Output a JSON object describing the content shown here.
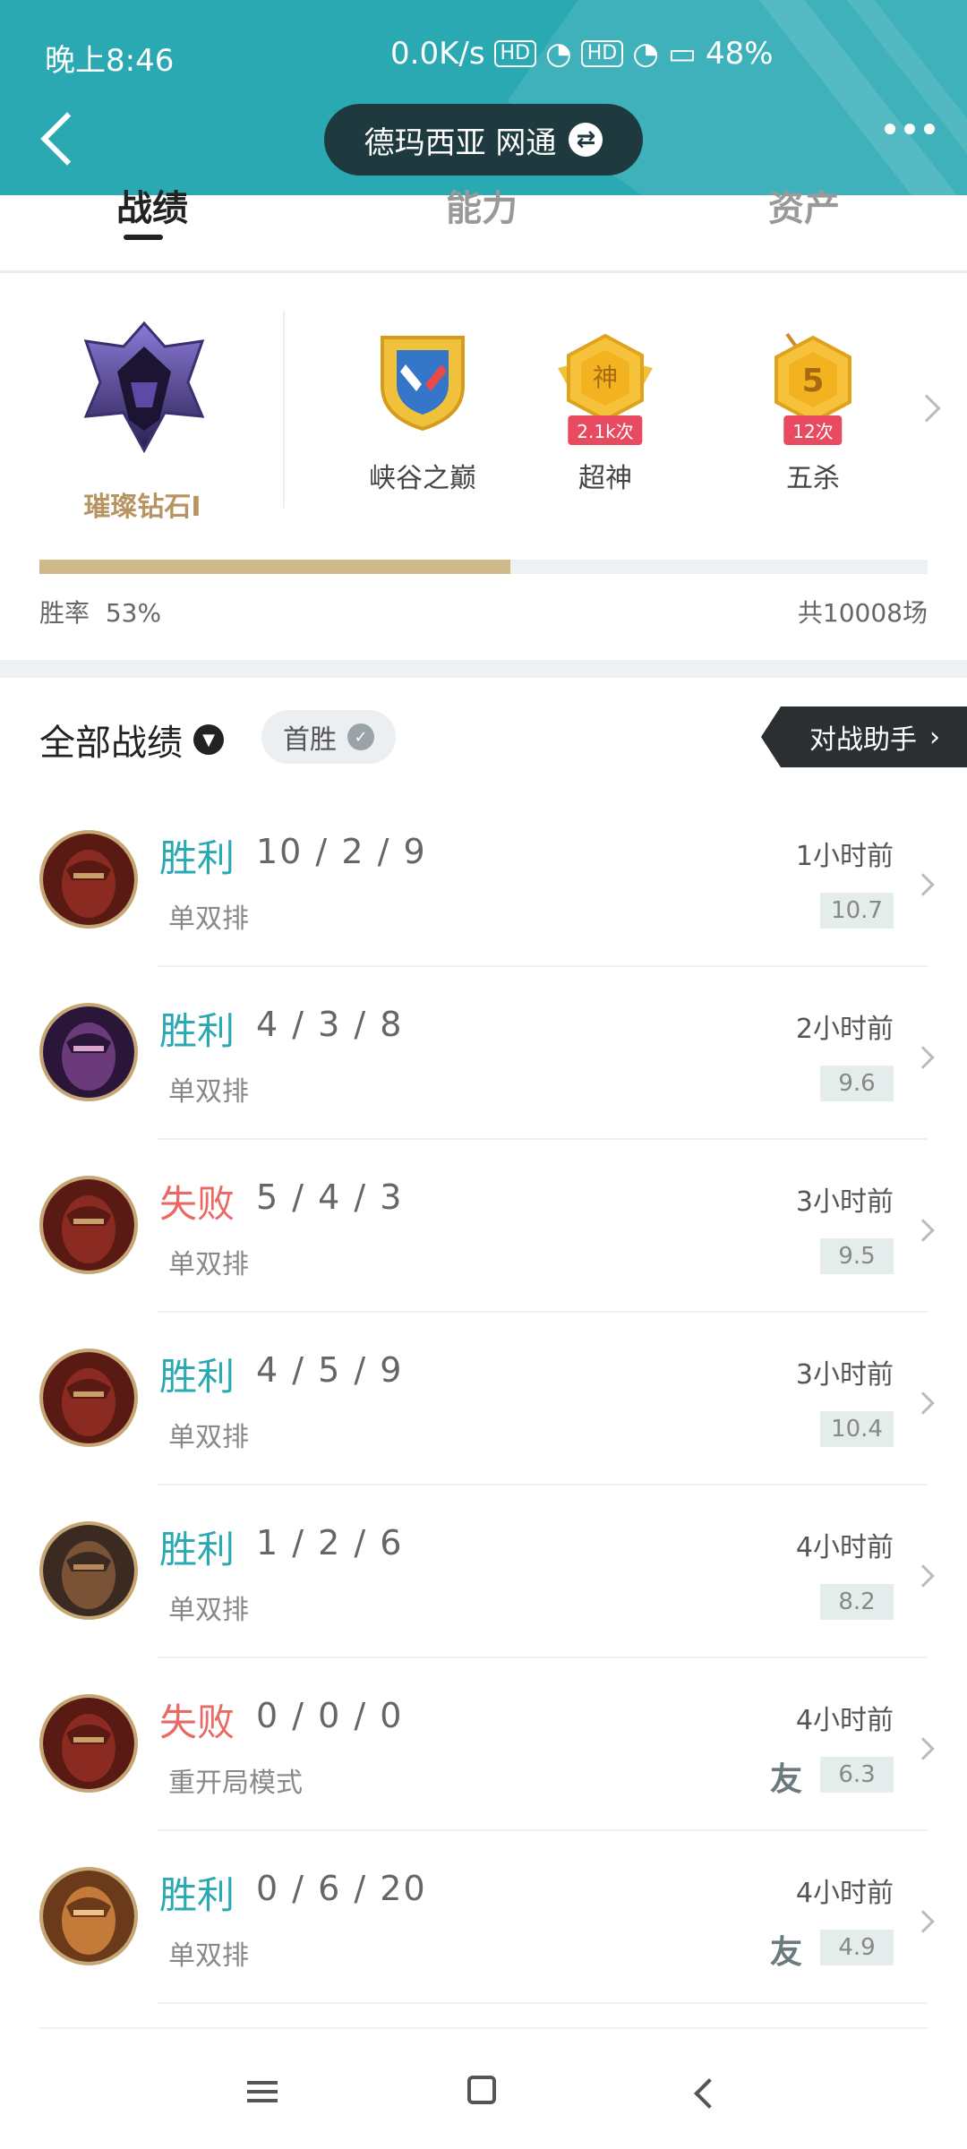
{
  "status_bar": {
    "time": "晚上8:46",
    "speed": "0.0K/s",
    "sig1": "HD",
    "sig2": "HD",
    "battery": "48%"
  },
  "header": {
    "server": "德玛西亚 网通",
    "back_icon": "chevron-left-icon",
    "more_icon": "more-dots-icon",
    "swap_icon": "swap-icon"
  },
  "tabs": [
    {
      "label": "战绩",
      "active": true
    },
    {
      "label": "能力",
      "active": false
    },
    {
      "label": "资产",
      "active": false
    }
  ],
  "rank": {
    "name": "璀璨钻石I",
    "badges": [
      {
        "label": "峡谷之巅",
        "count": ""
      },
      {
        "label": "超神",
        "count": "2.1k次"
      },
      {
        "label": "五杀",
        "count": "12次"
      }
    ],
    "win_rate_label": "胜率",
    "win_rate_value": "53%",
    "win_rate_fraction": 0.53,
    "total_matches": "共10008场"
  },
  "filter": {
    "title": "全部战绩",
    "chip": "首胜",
    "assist_button": "对战助手"
  },
  "matches": [
    {
      "result": "胜利",
      "type": "win",
      "kda": "10 / 2 / 9",
      "mode": "单双排",
      "time": "1小时前",
      "score": "10.7",
      "friend": false
    },
    {
      "result": "胜利",
      "type": "win",
      "kda": "4 / 3 / 8",
      "mode": "单双排",
      "time": "2小时前",
      "score": "9.6",
      "friend": false
    },
    {
      "result": "失败",
      "type": "loss",
      "kda": "5 / 4 / 3",
      "mode": "单双排",
      "time": "3小时前",
      "score": "9.5",
      "friend": false
    },
    {
      "result": "胜利",
      "type": "win",
      "kda": "4 / 5 / 9",
      "mode": "单双排",
      "time": "3小时前",
      "score": "10.4",
      "friend": false
    },
    {
      "result": "胜利",
      "type": "win",
      "kda": "1 / 2 / 6",
      "mode": "单双排",
      "time": "4小时前",
      "score": "8.2",
      "friend": false
    },
    {
      "result": "失败",
      "type": "loss",
      "kda": "0 / 0 / 0",
      "mode": "重开局模式",
      "time": "4小时前",
      "score": "6.3",
      "friend": true
    },
    {
      "result": "胜利",
      "type": "win",
      "kda": "0 / 6 / 20",
      "mode": "单双排",
      "time": "4小时前",
      "score": "4.9",
      "friend": true
    }
  ],
  "friend_label": "友",
  "colors": {
    "header": "#2aa9b3",
    "win": "#2aa9b3",
    "loss": "#e96a64",
    "rank_gold": "#b89463"
  }
}
